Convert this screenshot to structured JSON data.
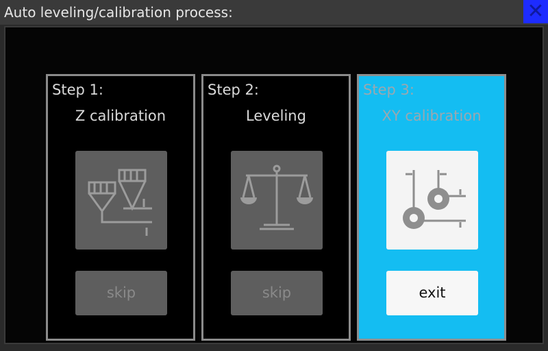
{
  "window": {
    "title": "Auto leveling/calibration process:"
  },
  "steps": [
    {
      "label": "Step 1:",
      "title": "Z calibration",
      "icon": "z-calibration-icon",
      "button": "skip"
    },
    {
      "label": "Step 2:",
      "title": "Leveling",
      "icon": "balance-scale-icon",
      "button": "skip"
    },
    {
      "label": "Step 3:",
      "title": "XY calibration",
      "icon": "xy-calibration-icon",
      "button": "exit"
    }
  ],
  "colors": {
    "active_panel": "#14bdf2",
    "close_button": "#1d2cff",
    "disabled_button": "#5e5e5e"
  }
}
